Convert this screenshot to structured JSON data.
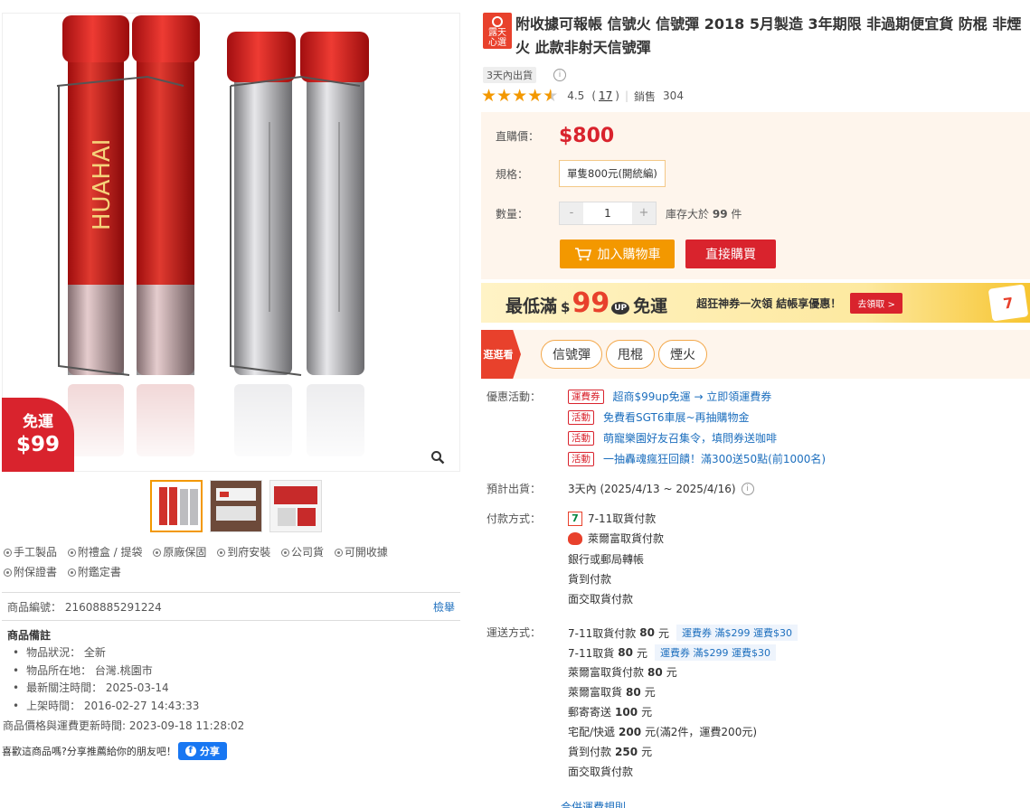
{
  "free_badge": {
    "line1": "免運",
    "line2": "$99"
  },
  "thumbnails": [
    "thumb-1",
    "thumb-2",
    "thumb-3"
  ],
  "service_tags": [
    "手工製品",
    "附禮盒 / 提袋",
    "原廠保固",
    "到府安裝",
    "公司貨",
    "可開收據",
    "附保證書",
    "附鑑定書"
  ],
  "product_code": {
    "label": "商品編號：",
    "value": "21608885291224",
    "report": "檢舉"
  },
  "notes": {
    "heading": "商品備註",
    "items": [
      "物品狀況： 全新",
      "物品所在地： 台灣.桃園市",
      "最新關注時間： 2025-03-14",
      "上架時間： 2016-02-27 14:43:33"
    ]
  },
  "price_update": "商品價格與運費更新時間: 2023-09-18 11:28:02",
  "share": {
    "text": "喜歡這商品嗎?分享推薦給你的朋友吧！",
    "button": "分享"
  },
  "mall_badge": "露天\n心選",
  "title": "附收據可報帳 信號火 信號彈 2018 5月製造 3年期限 非過期便宜貨 防棍 非煙火 此款非射天信號彈",
  "ship_tag": "3天內出貨",
  "rating": {
    "score": "4.5",
    "open": "(",
    "count": "17",
    "close": ")",
    "sales_label": "銷售",
    "sales": "304",
    "stars": 4.5
  },
  "price_box": {
    "price_label": "直購價：",
    "price": "$800",
    "spec_label": "規格：",
    "spec_value": "單隻800元(開統編)",
    "qty_label": "數量：",
    "qty_minus": "-",
    "qty_value": "1",
    "qty_plus": "+",
    "stock_prefix": "庫存大於",
    "stock_value": "99",
    "stock_suffix": "件",
    "cart_button": "加入購物車",
    "buy_button": "直接購買"
  },
  "banner": {
    "prefix": "最低滿",
    "dollar": "$",
    "amount": "99",
    "up": "UP",
    "suffix": "免運",
    "sub": "超狂神券一次領 結帳享優惠！",
    "cta": "去領取 >",
    "icon": "7"
  },
  "browse": {
    "label": "逛逛看",
    "chips": [
      "信號彈",
      "甩棍",
      "煙火"
    ]
  },
  "promotions": {
    "label": "優惠活動：",
    "items": [
      {
        "tag": "運費券",
        "text": "超商$99up免運 → 立即領運費券"
      },
      {
        "tag": "活動",
        "text": "免費看SGT6車展~再抽購物金"
      },
      {
        "tag": "活動",
        "text": "萌寵樂園好友召集令，填問券送咖啡"
      },
      {
        "tag": "活動",
        "text": "一抽轟魂瘋狂回饋！滿300送50點(前1000名)"
      }
    ]
  },
  "expected_ship": {
    "label": "預計出貨：",
    "value": "3天內 (2025/4/13 ~ 2025/4/16)"
  },
  "payment": {
    "label": "付款方式：",
    "items": [
      "7-11取貨付款",
      "萊爾富取貨付款",
      "銀行或郵局轉帳",
      "貨到付款",
      "面交取貨付款"
    ]
  },
  "shipping": {
    "label": "運送方式：",
    "items": [
      {
        "name": "7-11取貨付款",
        "price": "80",
        "unit": "元",
        "coupon": "運費券 滿$299 運費$30"
      },
      {
        "name": "7-11取貨",
        "price": "80",
        "unit": "元",
        "coupon": "運費券 滿$299 運費$30"
      },
      {
        "name": "萊爾富取貨付款",
        "price": "80",
        "unit": "元",
        "coupon": ""
      },
      {
        "name": "萊爾富取貨",
        "price": "80",
        "unit": "元",
        "coupon": ""
      },
      {
        "name": "郵寄寄送",
        "price": "100",
        "unit": "元",
        "coupon": ""
      },
      {
        "name": "宅配/快遞",
        "price": "200",
        "unit": "元(滿2件，運費200元)",
        "coupon": ""
      },
      {
        "name": "貨到付款",
        "price": "250",
        "unit": "元",
        "coupon": ""
      },
      {
        "name": "面交取貨付款",
        "price": "",
        "unit": "",
        "coupon": ""
      }
    ],
    "more": "合併運費規則"
  },
  "colors": {
    "accent_red": "#d9232d",
    "accent_orange": "#f39800",
    "link_blue": "#1d6fbe",
    "price_bg": "#fef5ec"
  }
}
